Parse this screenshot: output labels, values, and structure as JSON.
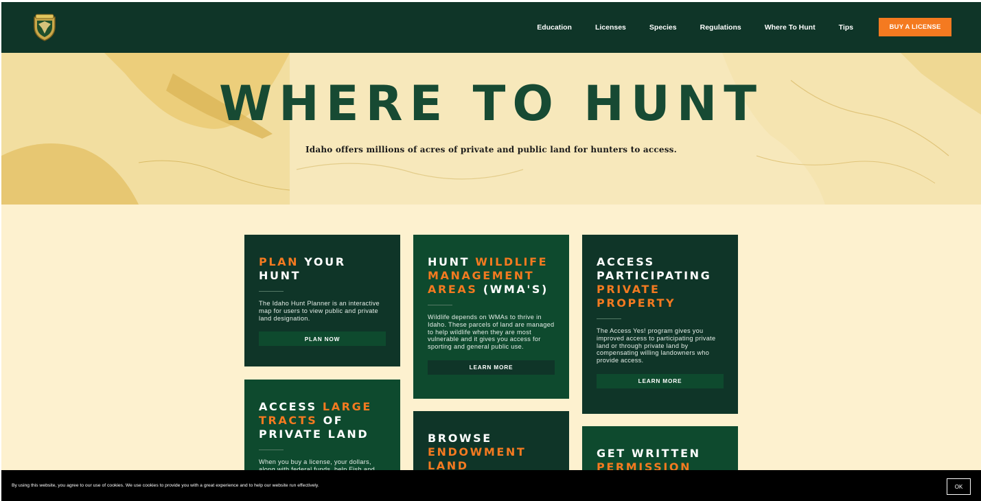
{
  "nav": {
    "logo_alt": "Idaho Fish and Game",
    "links": [
      "Education",
      "Licenses",
      "Species",
      "Regulations",
      "Where To Hunt",
      "Tips"
    ],
    "cta": "BUY A LICENSE"
  },
  "hero": {
    "title": "WHERE TO HUNT",
    "subtitle": "Idaho offers millions of acres of private and public land for hunters to access."
  },
  "cards": {
    "plan": {
      "title_hl": "PLAN",
      "title_rest": " YOUR HUNT",
      "body": "The Idaho Hunt Planner is an interactive map for users to view public and private land designation.",
      "button": "PLAN NOW"
    },
    "wma": {
      "title_a": "HUNT ",
      "title_hl": "WILDLIFE MANAGEMENT AREAS",
      "title_b": " (WMA'S)",
      "body": "Wildlife depends on WMAs to thrive in Idaho. These parcels of land are managed to help wildlife when they are most vulnerable and it gives you access for sporting and general public use.",
      "button": "LEARN MORE"
    },
    "access": {
      "title_a": "ACCESS PARTICIPATING ",
      "title_hl": "PRIVATE PROPERTY",
      "body": "The Access Yes! program gives you improved access to participating private land or through private land by compensating willing landowners who provide access.",
      "button": "LEARN MORE"
    },
    "large": {
      "title_a": "ACCESS ",
      "title_hl": "LARGE TRACTS",
      "title_b": " OF PRIVATE LAND",
      "body": "When you buy a license, your dollars, along with federal funds, help Fish and Game and partners"
    },
    "endowment": {
      "title_a": "BROWSE ",
      "title_hl": "ENDOWMENT LAND"
    },
    "written": {
      "title_a": "GET WRITTEN ",
      "title_hl": "PERMISSION"
    }
  },
  "cookie": {
    "text": "By using this website, you agree to our use of cookies. We use cookies to provide you with a great experience and to help our website run effectively.",
    "ok": "OK"
  },
  "colors": {
    "nav_bg": "#0f3528",
    "accent": "#f47a20",
    "title_green": "#174a33",
    "page_bg": "#fdf1cf"
  }
}
